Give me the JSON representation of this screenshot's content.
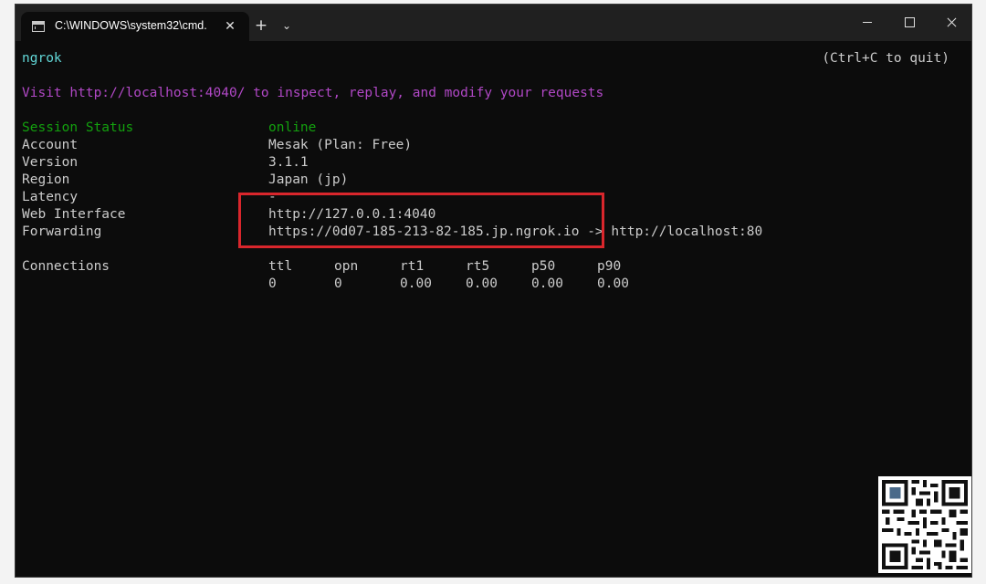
{
  "tab": {
    "title": "C:\\WINDOWS\\system32\\cmd.",
    "close": "✕"
  },
  "titlebar": {
    "new_tab": "+",
    "dropdown": "⌄"
  },
  "terminal": {
    "app_name": "ngrok",
    "quit_hint": "(Ctrl+C to quit)",
    "visit_line": "Visit http://localhost:4040/ to inspect, replay, and modify your requests",
    "fields": [
      {
        "label": "Session Status",
        "value": "online"
      },
      {
        "label": "Account",
        "value": "Mesak (Plan: Free)"
      },
      {
        "label": "Version",
        "value": "3.1.1"
      },
      {
        "label": "Region",
        "value": "Japan (jp)"
      },
      {
        "label": "Latency",
        "value": "-"
      },
      {
        "label": "Web Interface",
        "value": "http://127.0.0.1:4040"
      },
      {
        "label": "Forwarding",
        "value": "https://0d07-185-213-82-185.jp.ngrok.io -> http://localhost:80"
      }
    ],
    "connections": {
      "label": "Connections",
      "headers": [
        "ttl",
        "opn",
        "rt1",
        "rt5",
        "p50",
        "p90"
      ],
      "values": [
        "0",
        "0",
        "0.00",
        "0.00",
        "0.00",
        "0.00"
      ]
    }
  },
  "colors": {
    "background": "#0c0c0c",
    "text": "#cccccc",
    "app_name": "#61d6d6",
    "visit_line": "#b148c6",
    "status": "#13a10e",
    "highlight_box": "#d9262c"
  },
  "icons": {
    "tab": "terminal-icon",
    "minimize": "minimize-icon",
    "maximize": "maximize-icon",
    "close": "close-icon",
    "qr": "qr-code-icon"
  }
}
